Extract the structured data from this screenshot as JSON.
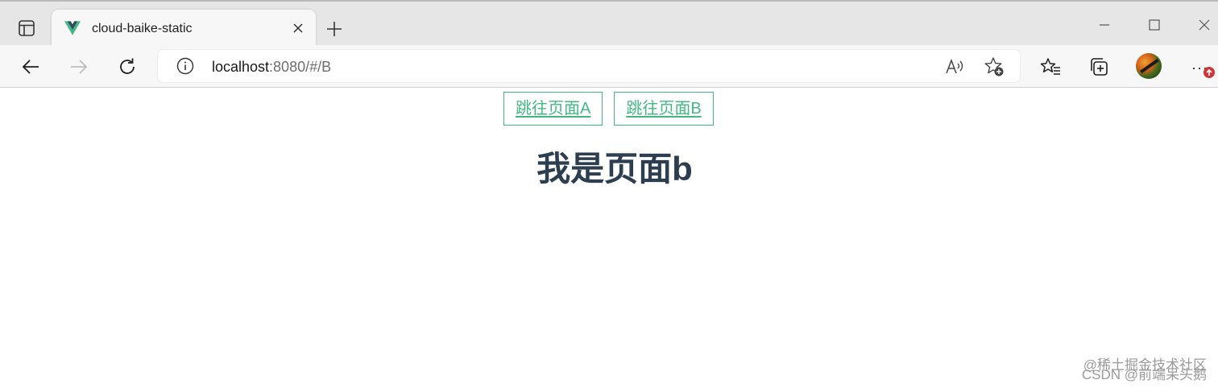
{
  "browser": {
    "tab": {
      "title": "cloud-baike-static",
      "favicon": "vue-logo-icon"
    },
    "address": {
      "host": "localhost",
      "rest": ":8080/#/B"
    },
    "colors": {
      "tabbar_bg": "#e6e6e6",
      "toolbar_bg": "#f7f7f7",
      "update_badge": "#d13438"
    }
  },
  "page": {
    "links": [
      {
        "label": "跳往页面A"
      },
      {
        "label": "跳往页面B"
      }
    ],
    "heading": "我是页面b",
    "colors": {
      "link": "#42b983",
      "heading": "#2c3e50"
    }
  },
  "watermark": {
    "line1": "@稀土掘金技术社区",
    "line2": "CSDN @前端呆头鹅"
  }
}
